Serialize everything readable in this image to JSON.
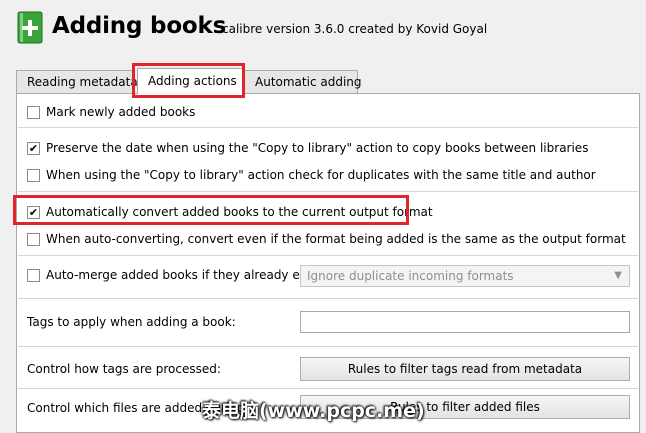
{
  "header": {
    "title": "Adding books",
    "subtitle": "calibre version 3.6.0 created by Kovid Goyal",
    "icon": "green-book-plus-icon"
  },
  "tabs": [
    {
      "label": "Reading metadata",
      "active": false
    },
    {
      "label": "Adding actions",
      "active": true
    },
    {
      "label": "Automatic adding",
      "active": false
    }
  ],
  "options": {
    "mark_new": {
      "label": "Mark newly added books",
      "checked": false
    },
    "preserve_date": {
      "label": "Preserve the date when using the \"Copy to library\" action to copy books between libraries",
      "checked": true
    },
    "check_duplicates": {
      "label": "When using the \"Copy to library\" action check for duplicates with the same title and author",
      "checked": false
    },
    "auto_convert": {
      "label": "Automatically convert added books to the current output format",
      "checked": true
    },
    "auto_convert_same": {
      "label": "When auto-converting, convert even if the format being added is the same as the output format",
      "checked": false
    },
    "auto_merge": {
      "label": "Auto-merge added books if they already exist:",
      "checked": false
    }
  },
  "auto_merge_dropdown": {
    "selected": "Ignore duplicate incoming formats"
  },
  "tags": {
    "label": "Tags to apply when adding a book:",
    "value": ""
  },
  "tag_rules": {
    "label": "Control how tags are processed:",
    "button": "Rules to filter tags read from metadata"
  },
  "file_rules": {
    "label": "Control which files are added during",
    "button": "Rules to filter added files"
  },
  "watermark": "泰电脑(www.pcpc.me)",
  "colors": {
    "highlight": "#e0262c",
    "icon_green": "#3aa33a"
  }
}
